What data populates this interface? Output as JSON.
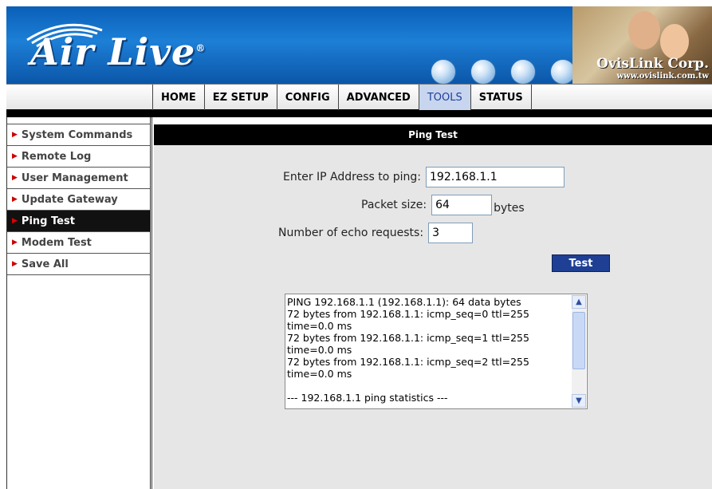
{
  "brand": {
    "logo_text": "Air Live",
    "registered": "®",
    "company": "OvisLink Corp.",
    "company_url": "www.ovislink.com.tw"
  },
  "nav": {
    "tabs": [
      {
        "label": "HOME",
        "active": false
      },
      {
        "label": "EZ SETUP",
        "active": false
      },
      {
        "label": "CONFIG",
        "active": false
      },
      {
        "label": "ADVANCED",
        "active": false
      },
      {
        "label": "TOOLS",
        "active": true
      },
      {
        "label": "STATUS",
        "active": false
      }
    ]
  },
  "sidebar": {
    "items": [
      {
        "label": "System Commands",
        "active": false
      },
      {
        "label": "Remote Log",
        "active": false
      },
      {
        "label": "User Management",
        "active": false
      },
      {
        "label": "Update Gateway",
        "active": false
      },
      {
        "label": "Ping Test",
        "active": true
      },
      {
        "label": "Modem Test",
        "active": false
      },
      {
        "label": "Save All",
        "active": false
      }
    ]
  },
  "main": {
    "title": "Ping Test",
    "ip_label": "Enter IP Address to ping:",
    "ip_value": "192.168.1.1",
    "packet_label": "Packet size:",
    "packet_value": "64",
    "packet_unit": "bytes",
    "echo_label": "Number of echo requests:",
    "echo_value": "3",
    "test_button": "Test",
    "output": "PING 192.168.1.1 (192.168.1.1): 64 data bytes\n72 bytes from 192.168.1.1: icmp_seq=0 ttl=255\ntime=0.0 ms\n72 bytes from 192.168.1.1: icmp_seq=1 ttl=255\ntime=0.0 ms\n72 bytes from 192.168.1.1: icmp_seq=2 ttl=255\ntime=0.0 ms\n\n--- 192.168.1.1 ping statistics ---"
  },
  "colors": {
    "header_blue": "#1d7fd6",
    "active_tab": "#c7d5ef",
    "button": "#1e3f93"
  }
}
